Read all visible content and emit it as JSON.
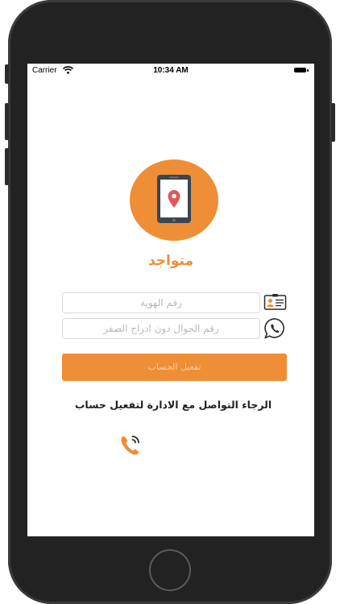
{
  "status_bar": {
    "carrier": "Carrier",
    "time": "10:34 AM"
  },
  "app": {
    "name": "متواجد",
    "brand_color": "#ee8e37"
  },
  "form": {
    "id_field": {
      "placeholder": "رقم الهوية",
      "value": ""
    },
    "phone_field": {
      "placeholder": "رقم الجوال دون ادراج الصفر",
      "value": ""
    },
    "submit_label": "تفعيل الحساب"
  },
  "contact": {
    "message": "الرجاء التواصل مع الادارة لتفعيل حساب"
  },
  "icons": {
    "logo": "tablet-location-pin-icon",
    "id_field": "id-card-icon",
    "phone_field": "whatsapp-icon",
    "contact": "phone-call-icon",
    "status": [
      "wifi-icon",
      "battery-icon"
    ]
  }
}
